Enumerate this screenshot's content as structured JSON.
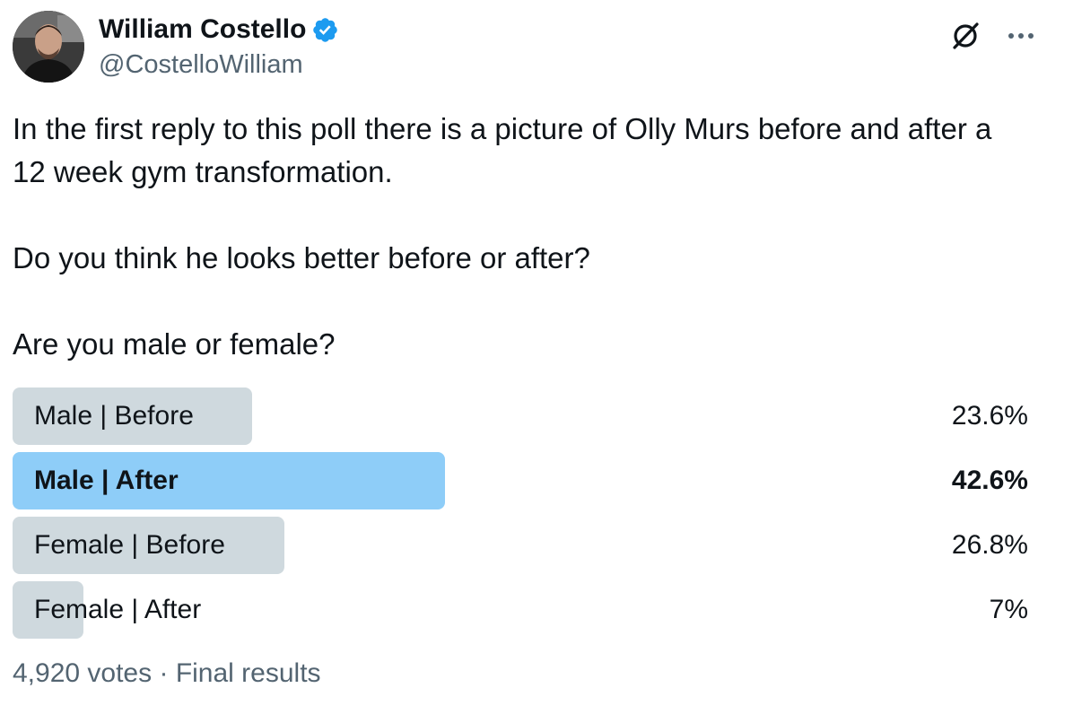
{
  "author": {
    "name": "William Costello",
    "handle": "@CostelloWilliam",
    "verified": true
  },
  "tweet": {
    "paragraphs": [
      "In the first reply to this poll there is a picture of Olly Murs before and after a 12 week gym transformation.",
      "Do you think he looks better before or after?",
      "Are you male or female?"
    ]
  },
  "poll": {
    "options": [
      {
        "label": "Male | Before",
        "percent_text": "23.6%",
        "percent": 23.6,
        "winner": false
      },
      {
        "label": "Male | After",
        "percent_text": "42.6%",
        "percent": 42.6,
        "winner": true
      },
      {
        "label": "Female | Before",
        "percent_text": "26.8%",
        "percent": 26.8,
        "winner": false
      },
      {
        "label": "Female | After",
        "percent_text": "7%",
        "percent": 7,
        "winner": false
      }
    ],
    "votes": "4,920 votes",
    "separator": "·",
    "status": "Final results"
  },
  "icons": {
    "verified": "verified-badge-icon",
    "grok": "grok-icon",
    "more": "more-options-icon"
  },
  "colors": {
    "verified": "#1d9bf0",
    "winner_bar": "#8ecdf8",
    "bar": "#cfd9de",
    "secondary_text": "#536471",
    "primary_text": "#0f1419"
  }
}
